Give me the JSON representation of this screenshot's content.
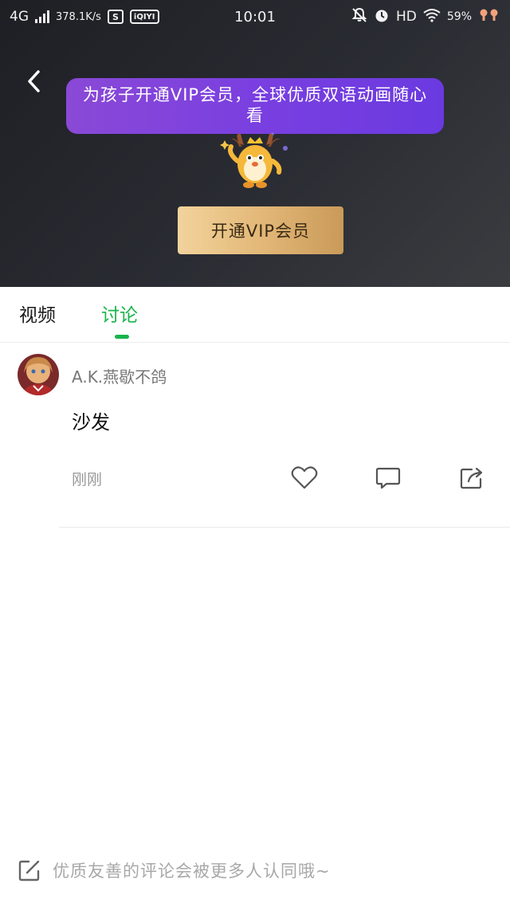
{
  "status_bar": {
    "network": "4G",
    "speed": "378.1K/s",
    "app_icon_s": "S",
    "app_icon_iqiyi": "iQIYI",
    "time": "10:01",
    "hd": "HD",
    "battery": "59%"
  },
  "hero": {
    "banner_text": "为孩子开通VIP会员，全球优质双语动画随心看",
    "vip_button_label": "开通VIP会员"
  },
  "tabs": {
    "video": "视频",
    "discuss": "讨论",
    "active": "discuss",
    "active_color": "#18b44a"
  },
  "comment": {
    "username": "A.K.燕歇不鸽",
    "text": "沙发",
    "time": "刚刚"
  },
  "input": {
    "placeholder": "优质友善的评论会被更多人认同哦~"
  },
  "icons": [
    "back-icon",
    "signal-icon",
    "mute-icon",
    "alarm-icon",
    "wifi-icon",
    "heart-icon",
    "comment-icon",
    "share-icon",
    "edit-icon"
  ]
}
